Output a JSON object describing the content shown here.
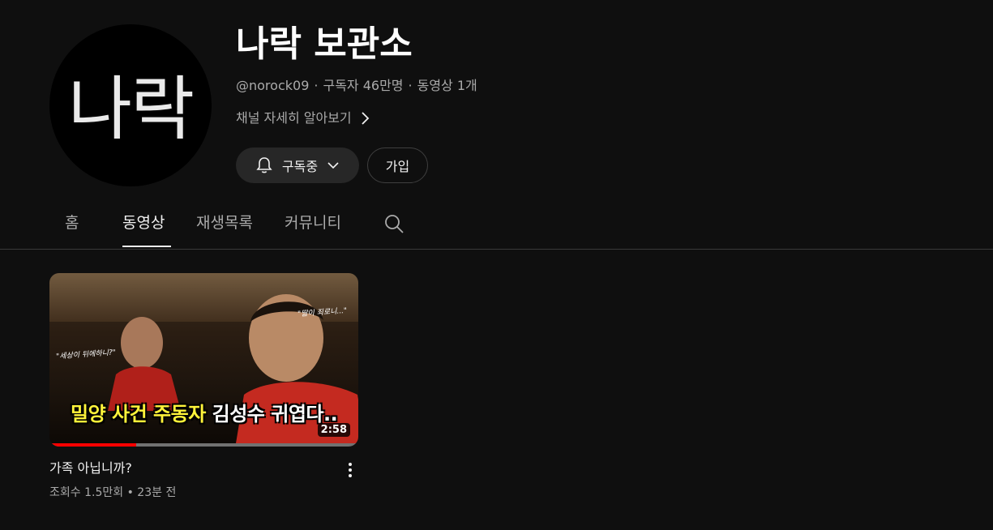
{
  "channel": {
    "avatar_text": "나락",
    "title": "나락 보관소",
    "handle": "@norock09",
    "subscribers": "구독자 46만명",
    "video_count": "동영상 1개",
    "more_about": "채널 자세히 알아보기",
    "subscribe_label": "구독중",
    "join_label": "가입"
  },
  "tabs": [
    {
      "label": "홈"
    },
    {
      "label": "동영상"
    },
    {
      "label": "재생목록"
    },
    {
      "label": "커뮤니티"
    }
  ],
  "active_tab": "동영상",
  "video": {
    "thumbnail_caption_left": "\"세상이 뒤에하니?\"",
    "thumbnail_caption_right": "\"딸이 죄로니...\"",
    "thumbnail_headline_part1": "밀양 사건 주동자",
    "thumbnail_headline_part2": "김성수 귀엽다..",
    "duration": "2:58",
    "watched_fraction": 0.28,
    "title": "가족 아닙니까?",
    "views": "조회수 1.5만회",
    "age": "23분 전"
  },
  "colors": {
    "background": "#0f0f0f",
    "progress": "#ff0000",
    "headline_yellow": "#fff33a"
  },
  "icons": {
    "bell": "bell-icon",
    "chevron_down": "chevron-down-icon",
    "chevron_right": "chevron-right-icon",
    "search": "search-icon",
    "more": "more-vert-icon"
  }
}
